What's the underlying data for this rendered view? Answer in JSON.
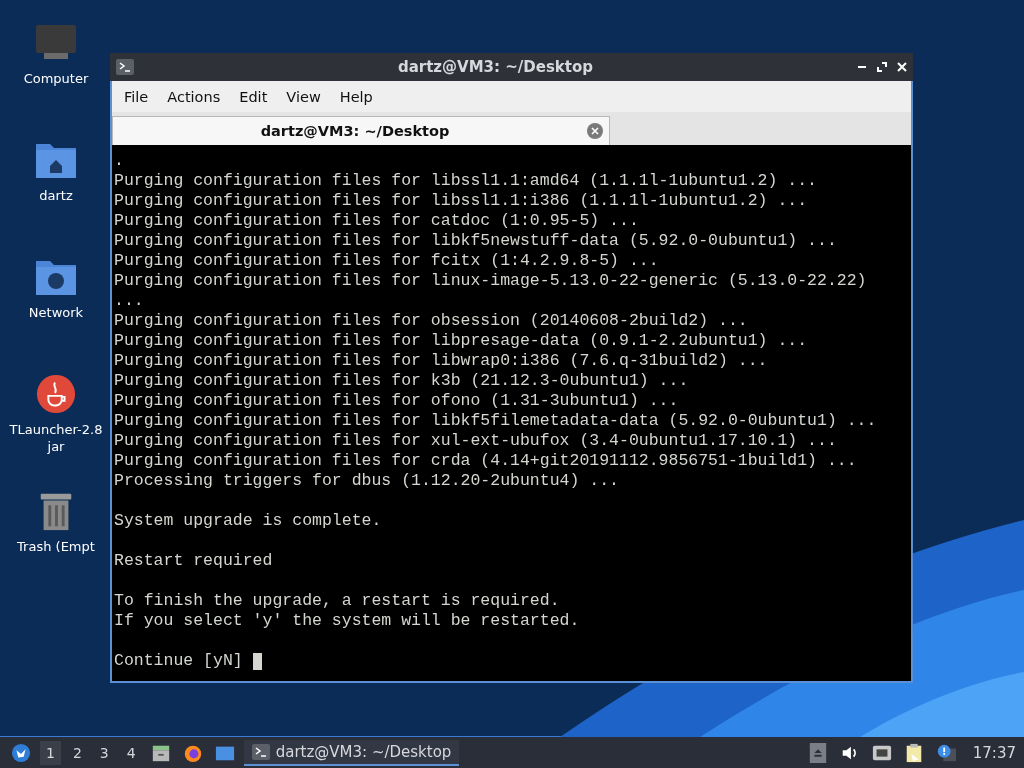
{
  "desktop_icons": [
    {
      "kind": "computer",
      "label": "Computer"
    },
    {
      "kind": "home-folder",
      "label": "dartz"
    },
    {
      "kind": "network-folder",
      "label": "Network"
    },
    {
      "kind": "java",
      "label": "TLauncher-2.8 jar"
    },
    {
      "kind": "trash",
      "label": "Trash (Empt"
    }
  ],
  "window": {
    "title": "dartz@VM3: ~/Desktop",
    "menu": [
      "File",
      "Actions",
      "Edit",
      "View",
      "Help"
    ],
    "tabs": [
      {
        "label": "dartz@VM3: ~/Desktop",
        "selected": true
      }
    ],
    "terminal": {
      "blocks": [
        [
          ".",
          "Purging configuration files for libssl1.1:amd64 (1.1.1l-1ubuntu1.2) ...",
          "Purging configuration files for libssl1.1:i386 (1.1.1l-1ubuntu1.2) ...",
          "Purging configuration files for catdoc (1:0.95-5) ...",
          "Purging configuration files for libkf5newstuff-data (5.92.0-0ubuntu1) ...",
          "Purging configuration files for fcitx (1:4.2.9.8-5) ...",
          "Purging configuration files for linux-image-5.13.0-22-generic (5.13.0-22.22)",
          "...",
          "Purging configuration files for obsession (20140608-2build2) ...",
          "Purging configuration files for libpresage-data (0.9.1-2.2ubuntu1) ...",
          "Purging configuration files for libwrap0:i386 (7.6.q-31build2) ...",
          "Purging configuration files for k3b (21.12.3-0ubuntu1) ...",
          "Purging configuration files for ofono (1.31-3ubuntu1) ...",
          "Purging configuration files for libkf5filemetadata-data (5.92.0-0ubuntu1) ...",
          "Purging configuration files for xul-ext-ubufox (3.4-0ubuntu1.17.10.1) ...",
          "Purging configuration files for crda (4.14+git20191112.9856751-1build1) ...",
          "Processing triggers for dbus (1.12.20-2ubuntu4) ..."
        ],
        [
          "System upgrade is complete."
        ],
        [
          "Restart required"
        ],
        [
          "To finish the upgrade, a restart is required.",
          "If you select 'y' the system will be restarted."
        ]
      ],
      "prompt": "Continue [yN]"
    }
  },
  "taskbar": {
    "workspaces": [
      {
        "label": "1",
        "selected": true
      },
      {
        "label": "2",
        "selected": false
      },
      {
        "label": "3",
        "selected": false
      },
      {
        "label": "4",
        "selected": false
      }
    ],
    "tasks": [
      {
        "label": "dartz@VM3: ~/Desktop",
        "selected": true
      }
    ],
    "clock": "17:37"
  }
}
